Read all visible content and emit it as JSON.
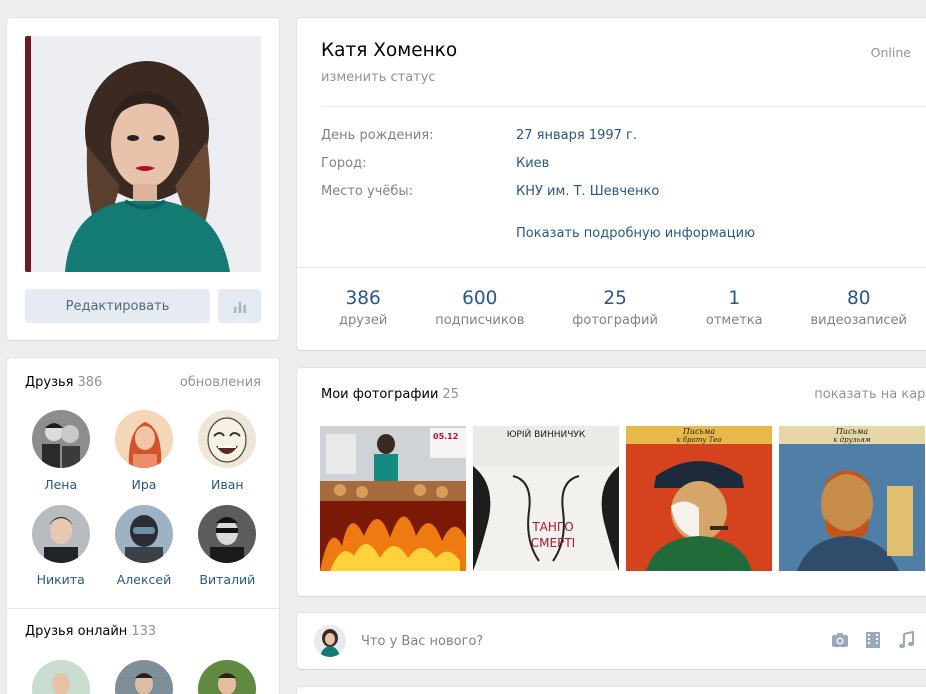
{
  "profile": {
    "name": "Катя Хоменко",
    "online": "Online",
    "change_status": "изменить статус",
    "info": [
      {
        "label": "День рождения:",
        "value": "27 января 1997 г."
      },
      {
        "label": "Город:",
        "value": "Киев"
      },
      {
        "label": "Место учёбы:",
        "value": "КНУ им. Т. Шевченко"
      }
    ],
    "show_more": "Показать подробную информацию",
    "counters": [
      {
        "num": "386",
        "label": "друзей"
      },
      {
        "num": "600",
        "label": "подписчиков"
      },
      {
        "num": "25",
        "label": "фотографий"
      },
      {
        "num": "1",
        "label": "отметка"
      },
      {
        "num": "80",
        "label": "видеозаписей"
      }
    ]
  },
  "avatar": {
    "edit_label": "Редактировать",
    "stats_icon": "bar-chart-icon"
  },
  "friends": {
    "title": "Друзья",
    "count": "386",
    "updates_link": "обновления",
    "items": [
      {
        "name": "Лена"
      },
      {
        "name": "Ира"
      },
      {
        "name": "Иван"
      },
      {
        "name": "Никита"
      },
      {
        "name": "Алексей"
      },
      {
        "name": "Виталий"
      }
    ]
  },
  "friends_online": {
    "title": "Друзья онлайн",
    "count": "133"
  },
  "photos": {
    "title": "Мои фотографии",
    "count": "25",
    "map_link": "показать на карте",
    "thumb_texts": {
      "p1_date": "05.12",
      "p2_author": "ЮРІЙ ВИННИЧУК",
      "p2_title1": "ТАНГО",
      "p2_title2": "СМЕРТІ",
      "p3_title": "Письма",
      "p3_sub": "к брату Тео",
      "p4_title": "Письма",
      "p4_sub": "к друзьям"
    }
  },
  "post": {
    "placeholder": "Что у Вас нового?",
    "icons": [
      "camera-icon",
      "video-icon",
      "music-icon"
    ]
  },
  "colors": {
    "link": "#2a5885",
    "muted": "#939393",
    "button_bg": "#e5ebf1",
    "page_bg": "#edeef0"
  }
}
